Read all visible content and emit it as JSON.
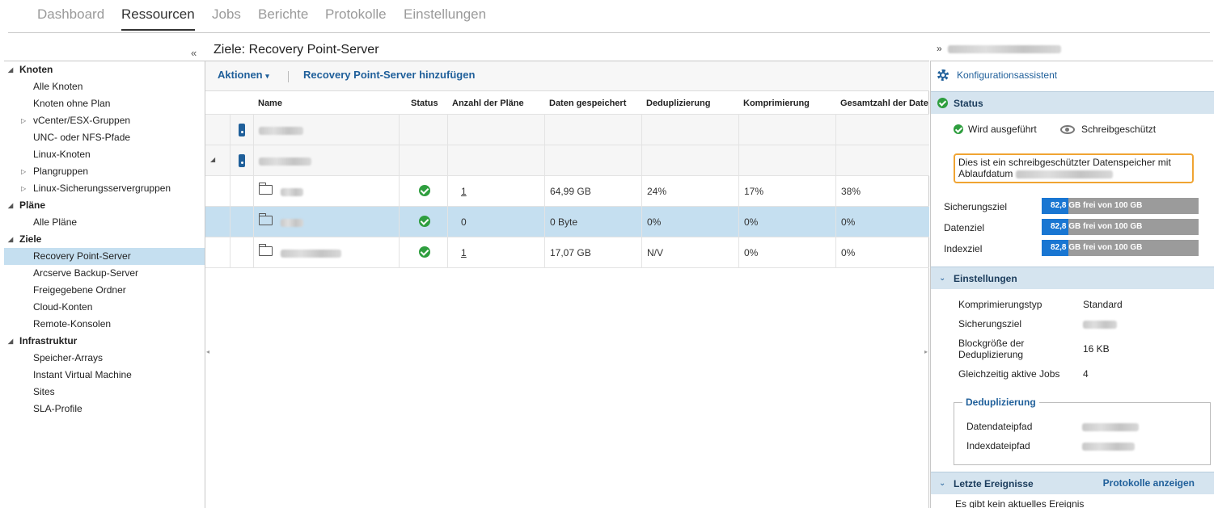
{
  "nav": {
    "tabs": [
      {
        "label": "Dashboard"
      },
      {
        "label": "Ressourcen"
      },
      {
        "label": "Jobs"
      },
      {
        "label": "Berichte"
      },
      {
        "label": "Protokolle"
      },
      {
        "label": "Einstellungen"
      }
    ],
    "active": "Ressourcen"
  },
  "tree": {
    "groups": [
      {
        "label": "Knoten",
        "items": [
          "Alle Knoten",
          "Knoten ohne Plan",
          "vCenter/ESX-Gruppen",
          "UNC- oder NFS-Pfade",
          "Linux-Knoten",
          "Plangruppen",
          "Linux-Sicherungsservergruppen"
        ]
      },
      {
        "label": "Pläne",
        "items": [
          "Alle Pläne"
        ]
      },
      {
        "label": "Ziele",
        "items": [
          "Recovery Point-Server",
          "Arcserve Backup-Server",
          "Freigegebene Ordner",
          "Cloud-Konten",
          "Remote-Konsolen"
        ]
      },
      {
        "label": "Infrastruktur",
        "items": [
          "Speicher-Arrays",
          "Instant Virtual Machine",
          "Sites",
          "SLA-Profile"
        ]
      }
    ],
    "selected": "Recovery Point-Server"
  },
  "center": {
    "title": "Ziele: Recovery Point-Server",
    "actions_label": "Aktionen",
    "add_label": "Recovery Point-Server hinzufügen",
    "columns": [
      "Name",
      "Status",
      "Anzahl der Pläne",
      "Daten gespeichert",
      "Deduplizierung",
      "Komprimierung",
      "Gesamtzahl der Date"
    ],
    "rows": [
      {
        "kind": "server",
        "plans": "",
        "stored": "",
        "dedup": "",
        "compr": "",
        "total": ""
      },
      {
        "kind": "server",
        "plans": "",
        "stored": "",
        "dedup": "",
        "compr": "",
        "total": ""
      },
      {
        "kind": "datastore",
        "status": "ok",
        "plans": "1",
        "stored": "64,99 GB",
        "dedup": "24%",
        "compr": "17%",
        "total": "38%"
      },
      {
        "kind": "datastore",
        "status": "ok",
        "plans": "0",
        "stored": "0 Byte",
        "dedup": "0%",
        "compr": "0%",
        "total": "0%"
      },
      {
        "kind": "datastore",
        "status": "ok",
        "plans": "1",
        "stored": "17,07 GB",
        "dedup": "N/V",
        "compr": "0%",
        "total": "0%"
      }
    ]
  },
  "right": {
    "wizard_label": "Konfigurationsassistent",
    "status_title": "Status",
    "running_label": "Wird ausgeführt",
    "readonly_label": "Schreibgeschützt",
    "notice_line1": "Dies ist ein schreibgeschützter Datenspeicher mit",
    "notice_line2": "Ablaufdatum",
    "bars": [
      {
        "label": "Sicherungsziel",
        "free": "82,8",
        "rest": "GB frei von 100 GB",
        "free_fraction": 0.17
      },
      {
        "label": "Datenziel",
        "free": "82,8",
        "rest": "GB frei von 100 GB",
        "free_fraction": 0.17
      },
      {
        "label": "Indexziel",
        "free": "82,8",
        "rest": "GB frei von 100 GB",
        "free_fraction": 0.17
      }
    ],
    "settings_title": "Einstellungen",
    "settings": {
      "compression_label": "Komprimierungstyp",
      "compression_value": "Standard",
      "target_label": "Sicherungsziel",
      "block_label_1": "Blockgröße der",
      "block_label_2": "Deduplizierung",
      "block_value": "16 KB",
      "jobs_label": "Gleichzeitig aktive Jobs",
      "jobs_value": "4"
    },
    "dedup_title": "Deduplizierung",
    "data_path_label": "Datendateipfad",
    "index_path_label": "Indexdateipfad",
    "events_title": "Letzte Ereignisse",
    "events_link": "Protokolle anzeigen",
    "events_empty": "Es gibt kein aktuelles Ereignis"
  },
  "colors": {
    "accent": "#1f5f9a",
    "selection": "#c5dff0",
    "ok": "#2e9e3e",
    "bar_fill": "#1976d2",
    "notice_border": "#f0a432"
  }
}
